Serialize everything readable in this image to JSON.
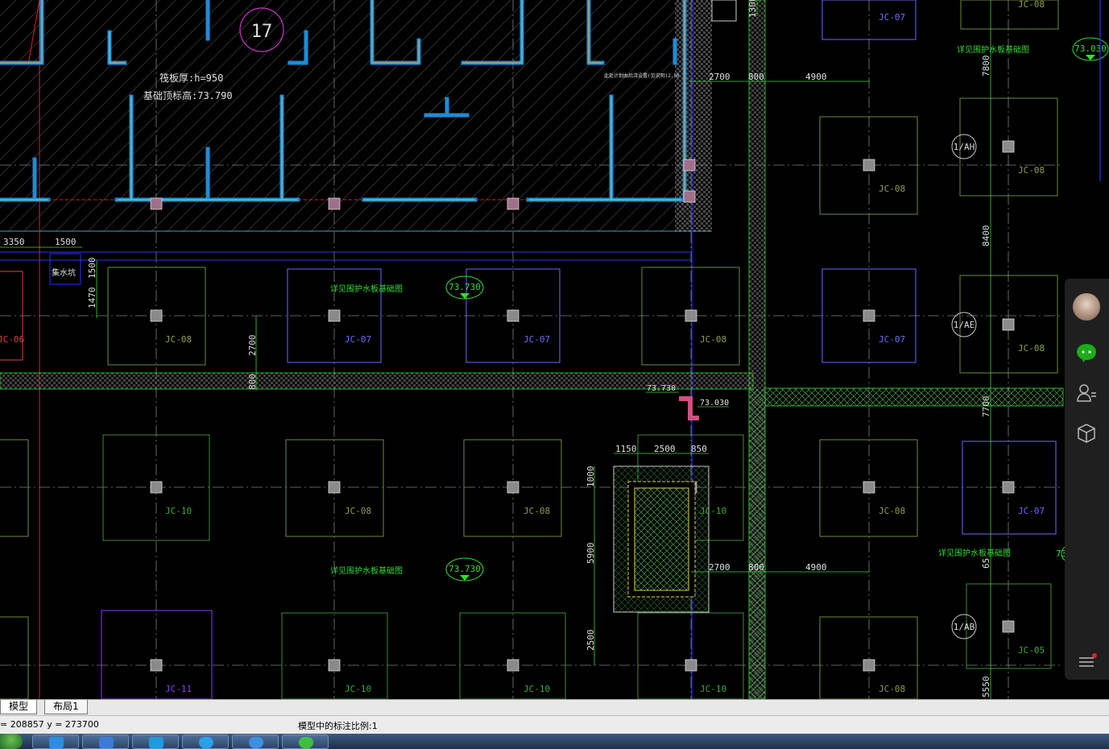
{
  "drawing": {
    "room_number": "17",
    "raft_thickness": "筏板厚:h=950",
    "foundation_top_elev": "基础顶标高:73.790",
    "small_note": "此处计划由后浇设置(见说明)2.50",
    "sump_label": "集水坑",
    "ref_note_text": "详见围护水板基础图",
    "footings": [
      "JC-07",
      "JC-08",
      "JC-05",
      "JC-06",
      "JC-10",
      "JC-11"
    ],
    "elevations": [
      "73.730",
      "73.730",
      "73.730",
      "73.030",
      "73.030",
      "73.030"
    ],
    "dimensions": {
      "top_row": [
        "2700",
        "800",
        "4900"
      ],
      "lower_row": [
        "2700",
        "800",
        "4900"
      ],
      "left_row": [
        "3350",
        "1500"
      ],
      "vertical_left": [
        "1500",
        "1470",
        "2700",
        "800"
      ],
      "sump_widths": [
        "1150",
        "2500",
        "850"
      ],
      "sump_heights": [
        "1000",
        "5900",
        "2500"
      ],
      "right_vertical": [
        "7800",
        "8400",
        "7700",
        "65",
        "5550",
        "1300"
      ]
    },
    "axis_bubbles": [
      "1/AH",
      "1/AE",
      "1/AB"
    ]
  },
  "tabs": {
    "model": "模型",
    "layout1": "布局1"
  },
  "status": {
    "coords": "= 208857  y = 273700",
    "scale_msg": "模型中的标注比例:1"
  },
  "taskbar": {
    "apps": [
      "start-orb",
      "qq-app",
      "qq-browser",
      "tencent-app",
      "shell-app",
      "ie-browser",
      "wechat-app"
    ]
  },
  "side_panel": {
    "icons": [
      "avatar-icon",
      "wechat-chat-icon",
      "contact-icon",
      "cube-icon",
      "menu-icon"
    ],
    "accent": "#1aad19"
  },
  "colors": {
    "background": "#000000",
    "grid": "#8a8a8a",
    "wall": "#1e8cd6",
    "wall_core": "#d8c060",
    "dim": "#33dd33",
    "hatch": "#ffffff",
    "footing_green": "#6c8c3c",
    "footing_blue": "#6a6aff",
    "column": "#9a9a9a",
    "room_circle": "#cc33cc"
  }
}
